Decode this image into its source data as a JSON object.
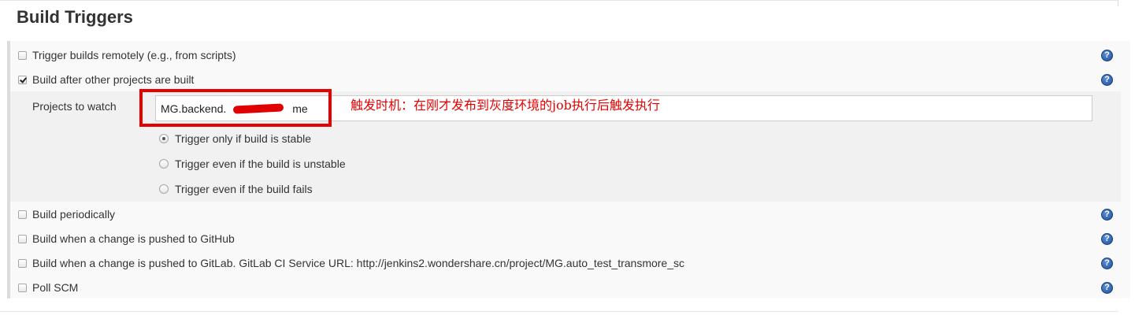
{
  "section": {
    "title": "Build Triggers"
  },
  "triggers": [
    {
      "label": "Trigger builds remotely (e.g., from scripts)",
      "checked": false
    },
    {
      "label": "Build after other projects are built",
      "checked": true
    },
    {
      "label": "Build periodically",
      "checked": false
    },
    {
      "label": "Build when a change is pushed to GitHub",
      "checked": false
    },
    {
      "label": "Build when a change is pushed to GitLab. GitLab CI Service URL: http://jenkins2.wondershare.cn/project/MG.auto_test_transmore_sc",
      "checked": false
    },
    {
      "label": "Poll SCM",
      "checked": false
    }
  ],
  "watch": {
    "label": "Projects to watch",
    "value_prefix": "MG.backend.",
    "value_suffix": "me",
    "options": [
      {
        "label": "Trigger only if build is stable",
        "selected": true
      },
      {
        "label": "Trigger even if the build is unstable",
        "selected": false
      },
      {
        "label": "Trigger even if the build fails",
        "selected": false
      }
    ]
  },
  "annotation": "触发时机：在刚才发布到灰度环境的job执行后触发执行",
  "help_icon_glyph": "?",
  "colors": {
    "annotation_red": "#e60000",
    "help_blue": "#1f4f99"
  }
}
